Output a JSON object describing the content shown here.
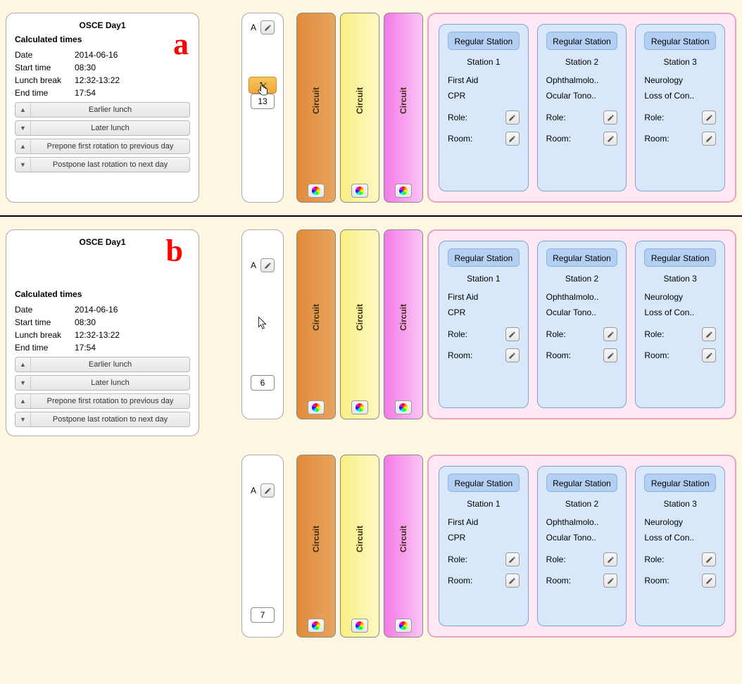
{
  "markers": {
    "a": "a",
    "b": "b"
  },
  "day_title": "OSCE Day1",
  "calc_label": "Calculated times",
  "fields": {
    "date_k": "Date",
    "date_v": "2014-06-16",
    "start_k": "Start time",
    "start_v": "08:30",
    "lunch_k": "Lunch break",
    "lunch_v": "12:32-13:22",
    "end_k": "End time",
    "end_v": "17:54"
  },
  "buttons": {
    "earlier": "Earlier lunch",
    "later": "Later lunch",
    "prepone": "Prepone first rotation to previous day",
    "postpone": "Postpone last rotation to next day"
  },
  "parcour": {
    "label": "A",
    "count_a": "13",
    "count_b1": "6",
    "count_b2": "7"
  },
  "circuit_label": "Circuit",
  "stations": [
    {
      "head": "Regular Station",
      "name": "Station 1",
      "l1": "First Aid",
      "l2": "CPR",
      "role": "Role:",
      "room": "Room:"
    },
    {
      "head": "Regular Station",
      "name": "Station 2",
      "l1": "Ophthalmolo..",
      "l2": "Ocular Tono..",
      "role": "Role:",
      "room": "Room:"
    },
    {
      "head": "Regular Station",
      "name": "Station 3",
      "l1": "Neurology",
      "l2": "Loss of Con..",
      "role": "Role:",
      "room": "Room:"
    }
  ]
}
